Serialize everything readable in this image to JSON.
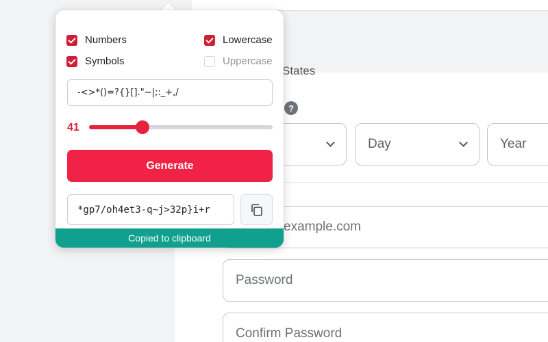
{
  "background": {
    "partial_label": "States",
    "help_icon_glyph": "?",
    "selects": [
      {
        "label": ""
      },
      {
        "label": "Day"
      },
      {
        "label": "Year"
      }
    ],
    "email_placeholder": "example.com",
    "password_placeholder": "Password",
    "confirm_placeholder": "Confirm Password"
  },
  "popup": {
    "options": {
      "numbers": {
        "label": "Numbers",
        "checked": true
      },
      "lowercase": {
        "label": "Lowercase",
        "checked": true
      },
      "symbols": {
        "label": "Symbols",
        "checked": true
      },
      "uppercase": {
        "label": "Uppercase",
        "checked": false
      }
    },
    "symbols_value": "-<>*()=?{}[].\"~|;:_+,/",
    "length": {
      "value": "41",
      "fraction": 0.29
    },
    "generate_label": "Generate",
    "generated_password": "*gp7/oh4et3-q~j>32p}i+r",
    "copy_icon": "copy-icon",
    "toast": "Copied to clipboard"
  },
  "colors": {
    "accent": "#f02346",
    "toast": "#11a08e"
  }
}
